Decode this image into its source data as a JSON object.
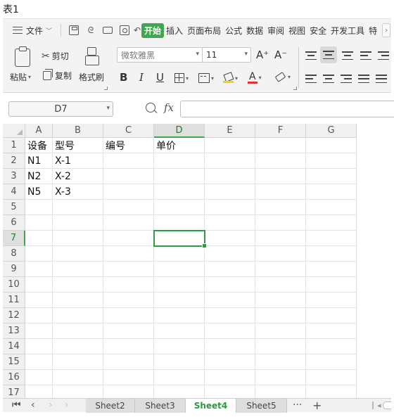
{
  "caption": "表1",
  "menubar": {
    "file_label": "文件",
    "tabs": [
      "开始",
      "插入",
      "页面布局",
      "公式",
      "数据",
      "审阅",
      "视图",
      "安全",
      "开发工具",
      "特"
    ],
    "active_tab": "开始"
  },
  "toolbar": {
    "paste_label": "粘贴",
    "cut_label": "剪切",
    "copy_label": "复制",
    "format_painter_label": "格式刷",
    "font_name": "微软雅黑",
    "font_size": "11",
    "bold_glyph": "B",
    "italic_glyph": "I",
    "underline_glyph": "U",
    "increase_font_glyph": "A⁺",
    "decrease_font_glyph": "A⁻",
    "font_color_glyph": "A"
  },
  "formula_bar": {
    "name_box": "D7",
    "fx_label": "fx",
    "formula": ""
  },
  "sheet": {
    "columns": [
      "A",
      "B",
      "C",
      "D",
      "E",
      "F",
      "G"
    ],
    "active_column": "D",
    "rows": [
      "1",
      "2",
      "3",
      "4",
      "5",
      "6",
      "7",
      "8",
      "9",
      "10",
      "11",
      "12",
      "13",
      "14",
      "15",
      "16",
      "17"
    ],
    "active_row": "7",
    "selected_cell": "D7",
    "cells": [
      [
        "设备",
        "型号",
        "编号",
        "单价",
        "",
        "",
        ""
      ],
      [
        "N1",
        "X-1",
        "",
        "",
        "",
        "",
        ""
      ],
      [
        "N2",
        "X-2",
        "",
        "",
        "",
        "",
        ""
      ],
      [
        "N5",
        "X-3",
        "",
        "",
        "",
        "",
        ""
      ]
    ]
  },
  "sheet_tabs": {
    "tabs": [
      "Sheet2",
      "Sheet3",
      "Sheet4",
      "Sheet5"
    ],
    "active": "Sheet4",
    "more_glyph": "···",
    "add_glyph": "+"
  }
}
